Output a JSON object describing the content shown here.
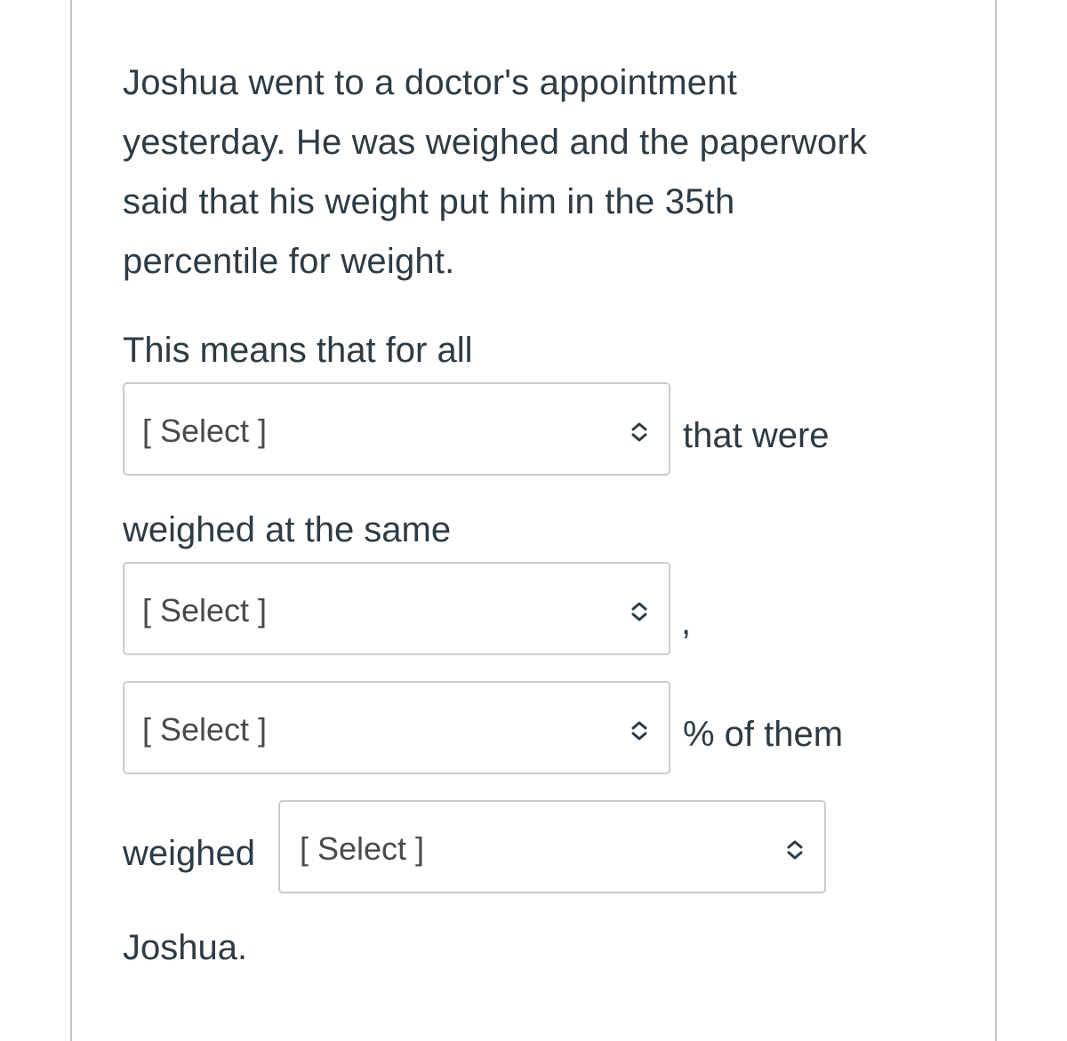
{
  "question": {
    "intro": "Joshua went to a doctor's appointment yesterday. He was weighed and the paperwork said that his weight put him in the 35th percentile for weight.",
    "intro_lines": [
      "Joshua went to a doctor's appointment",
      "yesterday. He was weighed and the paperwork",
      "said that his weight put him in the 35th",
      "percentile for weight."
    ],
    "text_1": "This means that for all",
    "text_2": "that were",
    "text_3": "weighed at the same",
    "text_4": ",",
    "text_5": "% of them",
    "text_6": "weighed",
    "text_7": "Joshua."
  },
  "dropdowns": [
    {
      "selected": "[ Select ]",
      "icon": "chevron-up-down-icon"
    },
    {
      "selected": "[ Select ]",
      "icon": "chevron-up-down-icon"
    },
    {
      "selected": "[ Select ]",
      "icon": "chevron-up-down-icon"
    },
    {
      "selected": "[ Select ]",
      "icon": "chevron-up-down-icon"
    }
  ]
}
